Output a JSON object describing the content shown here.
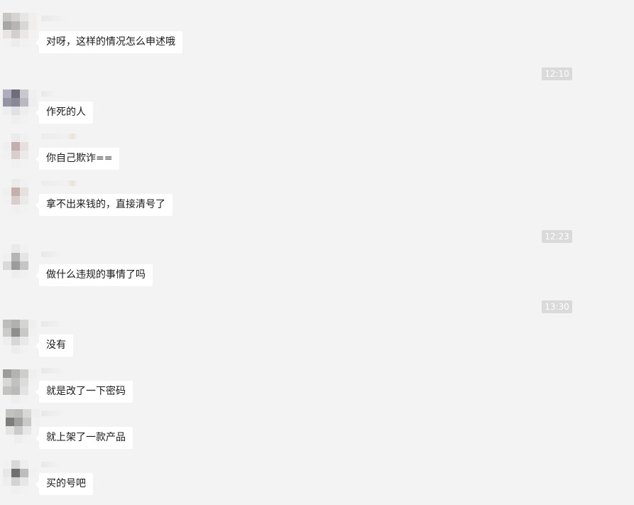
{
  "messages": [
    {
      "text": "对呀，这样的情况怎么申述哦"
    },
    {
      "text": "作死的人"
    },
    {
      "text": "你自己欺诈=="
    },
    {
      "text": "拿不出来钱的，直接清号了"
    },
    {
      "text": "做什么违规的事情了吗"
    },
    {
      "text": "没有"
    },
    {
      "text": "就是改了一下密码"
    },
    {
      "text": "就上架了一款产品"
    },
    {
      "text": "买的号吧"
    }
  ],
  "timestamps": [
    "12:10",
    "12:23",
    "13:30"
  ],
  "colors": {
    "chat_background": "#f3f3f3",
    "bubble": "#ffffff",
    "timestamp_badge": "#dadada"
  }
}
